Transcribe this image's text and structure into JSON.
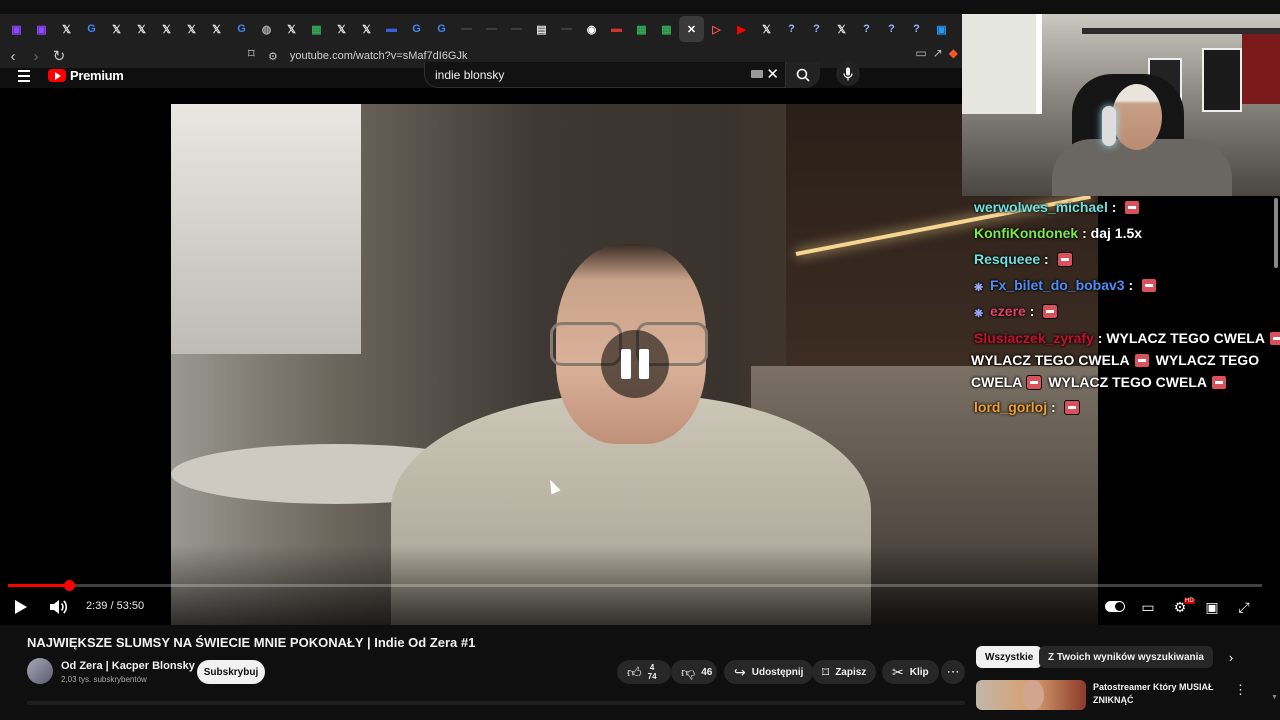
{
  "browser": {
    "tabs": [
      {
        "icon": "twitch-icon",
        "glyph": "▣",
        "color": "#9146ff"
      },
      {
        "icon": "twitch-icon",
        "glyph": "▣",
        "color": "#9146ff"
      },
      {
        "icon": "x-icon",
        "glyph": "𝕏",
        "color": "#e7e9ea"
      },
      {
        "icon": "google-icon",
        "glyph": "G",
        "color": "#4285f4"
      },
      {
        "icon": "x-icon",
        "glyph": "𝕏",
        "color": "#e7e9ea"
      },
      {
        "icon": "x-icon",
        "glyph": "𝕏",
        "color": "#e7e9ea"
      },
      {
        "icon": "x-icon",
        "glyph": "𝕏",
        "color": "#e7e9ea"
      },
      {
        "icon": "x-icon",
        "glyph": "𝕏",
        "color": "#e7e9ea"
      },
      {
        "icon": "x-icon",
        "glyph": "𝕏",
        "color": "#e7e9ea"
      },
      {
        "icon": "google-icon",
        "glyph": "G",
        "color": "#4285f4"
      },
      {
        "icon": "globe-icon",
        "glyph": "◍",
        "color": "#aaaaaa"
      },
      {
        "icon": "x-icon",
        "glyph": "𝕏",
        "color": "#e7e9ea"
      },
      {
        "icon": "sheets-icon",
        "glyph": "▦",
        "color": "#34a853"
      },
      {
        "icon": "x-icon",
        "glyph": "𝕏",
        "color": "#e7e9ea"
      },
      {
        "icon": "x-icon",
        "glyph": "𝕏",
        "color": "#e7e9ea"
      },
      {
        "icon": "news-icon",
        "glyph": "▬",
        "color": "#3b5bdb"
      },
      {
        "icon": "google-icon",
        "glyph": "G",
        "color": "#4285f4"
      },
      {
        "icon": "google-icon",
        "glyph": "G",
        "color": "#4285f4"
      },
      {
        "icon": "dash-icon",
        "glyph": "—",
        "color": "#555555"
      },
      {
        "icon": "dash-icon",
        "glyph": "—",
        "color": "#555555"
      },
      {
        "icon": "dash-icon",
        "glyph": "—",
        "color": "#555555"
      },
      {
        "icon": "document-icon",
        "glyph": "▤",
        "color": "#dddddd"
      },
      {
        "icon": "dash-icon",
        "glyph": "—",
        "color": "#555555"
      },
      {
        "icon": "chatgpt-icon",
        "glyph": "◉",
        "color": "#ffffff"
      },
      {
        "icon": "news-red-icon",
        "glyph": "▬",
        "color": "#d32f2f"
      },
      {
        "icon": "sheets-icon",
        "glyph": "▦",
        "color": "#34a853"
      },
      {
        "icon": "sheets-icon",
        "glyph": "▦",
        "color": "#34a853"
      },
      {
        "icon": "close-icon",
        "glyph": "✕",
        "color": "#ffffff",
        "active": true
      },
      {
        "icon": "play-outline-icon",
        "glyph": "▷",
        "color": "#ff5252"
      },
      {
        "icon": "youtube-icon",
        "glyph": "▶",
        "color": "#ff0000"
      },
      {
        "icon": "x-icon",
        "glyph": "𝕏",
        "color": "#e7e9ea"
      },
      {
        "icon": "question-icon",
        "glyph": "?",
        "color": "#9ab4ff"
      },
      {
        "icon": "question-icon",
        "glyph": "?",
        "color": "#9ab4ff"
      },
      {
        "icon": "x-icon",
        "glyph": "𝕏",
        "color": "#e7e9ea"
      },
      {
        "icon": "question-icon",
        "glyph": "?",
        "color": "#9ab4ff"
      },
      {
        "icon": "question-icon",
        "glyph": "?",
        "color": "#9ab4ff"
      },
      {
        "icon": "question-icon",
        "glyph": "?",
        "color": "#9ab4ff"
      },
      {
        "icon": "tab-blue-icon",
        "glyph": "▣",
        "color": "#2196f3"
      }
    ],
    "url": "youtube.com/watch?v=sMaf7dI6GJk"
  },
  "youtube": {
    "logo_text": "Premium",
    "search_value": "indie blonsky"
  },
  "player": {
    "time": "2:39 / 53:50",
    "progress": 0.049
  },
  "chat": [
    {
      "user": "werwolwes_michael",
      "color": "#6fe0df",
      "msg": "",
      "emote": true,
      "badge": false
    },
    {
      "user": "KonfiKondonek",
      "color": "#7be84a",
      "msg": "daj 1.5x",
      "emote": false,
      "badge": false
    },
    {
      "user": "Resqueee",
      "color": "#6fe0df",
      "msg": "",
      "emote": true,
      "badge": false
    },
    {
      "user": "Fx_bilet_do_bobav3",
      "color": "#4d8cf5",
      "msg": "",
      "emote": true,
      "badge": true
    },
    {
      "user": "ezere",
      "color": "#e0446e",
      "msg": "",
      "emote": true,
      "badge": true
    },
    {
      "user": "Slusiaczek_zyrafy",
      "color": "#c8102e",
      "msg": "WYLACZ TEGO CWELA",
      "emote": true,
      "badge": false
    },
    {
      "user": "",
      "color": "#ffffff",
      "msg": "WYLACZ TEGO CWELA",
      "emote": true,
      "badge": false,
      "suffix": "WYLACZ TEGO"
    },
    {
      "user": "",
      "color": "#ffffff",
      "msg": "CWELA",
      "emote": true,
      "badge": false,
      "suffix": "WYLACZ TEGO CWELA"
    },
    {
      "user": "lord_gorloj",
      "color": "#f0a030",
      "msg": "",
      "emote": true,
      "badge": false
    }
  ],
  "video": {
    "title": "NAJWIĘKSZE SLUMSY NA ŚWIECIE MNIE POKONAŁY | Indie Od Zera #1",
    "channel": "Od Zera | Kacper Blonsky",
    "subscribers": "2,03 tys. subskrybentów",
    "subscribe_label": "Subskrybuj",
    "like_count_lines": [
      "4",
      "74"
    ],
    "dislike_count": "46",
    "share_label": "Udostępnij",
    "save_label": "Zapisz",
    "clip_label": "Klip"
  },
  "sidebar": {
    "chips": [
      "Wszystkie",
      "Z Twoich wyników wyszukiwania"
    ],
    "recommendation_title": "Patostreamer Który MUSIAŁ ZNIKNĄĆ"
  }
}
